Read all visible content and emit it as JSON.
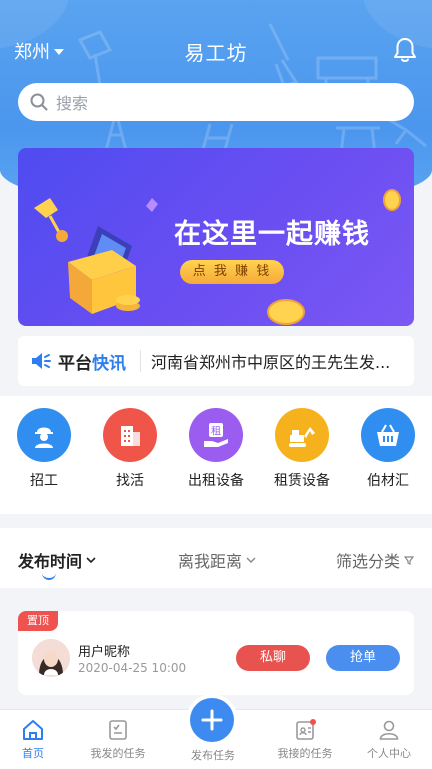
{
  "header": {
    "city": "郑州",
    "title": "易工坊",
    "search_placeholder": "搜索"
  },
  "banner": {
    "headline": "在这里一起赚钱",
    "button_label": "点 我 赚 钱"
  },
  "news": {
    "tag_prefix": "平台",
    "tag_suffix": "快讯",
    "text": "河南省郑州市中原区的王先生发..."
  },
  "categories": [
    {
      "label": "招工",
      "color": "#2f8ef0",
      "icon": "worker-icon"
    },
    {
      "label": "找活",
      "color": "#f0554a",
      "icon": "building-icon"
    },
    {
      "label": "出租设备",
      "color": "#9b5cf0",
      "icon": "rent-hand-icon"
    },
    {
      "label": "租赁设备",
      "color": "#f5b21c",
      "icon": "excavator-icon"
    },
    {
      "label": "伯材汇",
      "color": "#2f8ef0",
      "icon": "basket-icon"
    }
  ],
  "rent_glyph": "租",
  "sort": {
    "time": "发布时间",
    "distance": "离我距离",
    "filter": "筛选分类"
  },
  "card": {
    "pin": "置顶",
    "user_name": "用户昵称",
    "date": "2020-04-25 10:00",
    "chat_label": "私聊",
    "grab_label": "抢单"
  },
  "tabbar": {
    "home": "首页",
    "my_posted": "我发的任务",
    "publish": "发布任务",
    "my_accepted": "我接的任务",
    "profile": "个人中心"
  }
}
